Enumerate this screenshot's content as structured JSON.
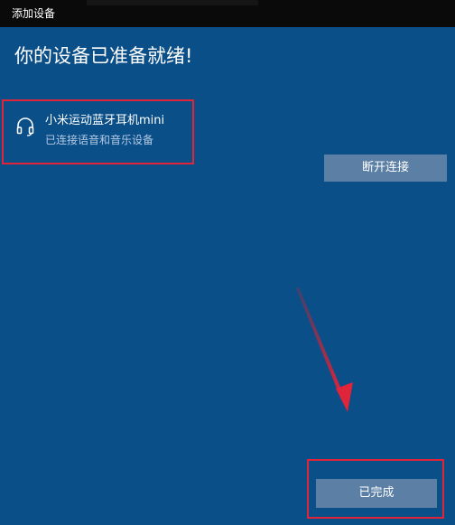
{
  "window": {
    "title": "添加设备"
  },
  "main": {
    "heading": "你的设备已准备就绪!"
  },
  "device": {
    "icon": "headphones-icon",
    "name": "小米运动蓝牙耳机mini",
    "status": "已连接语音和音乐设备"
  },
  "actions": {
    "disconnect_label": "断开连接",
    "done_label": "已完成"
  },
  "colors": {
    "background": "#0b4f88",
    "titlebar": "#0a0a0a",
    "button": "#5b7fa5",
    "highlight": "#e0243a"
  }
}
